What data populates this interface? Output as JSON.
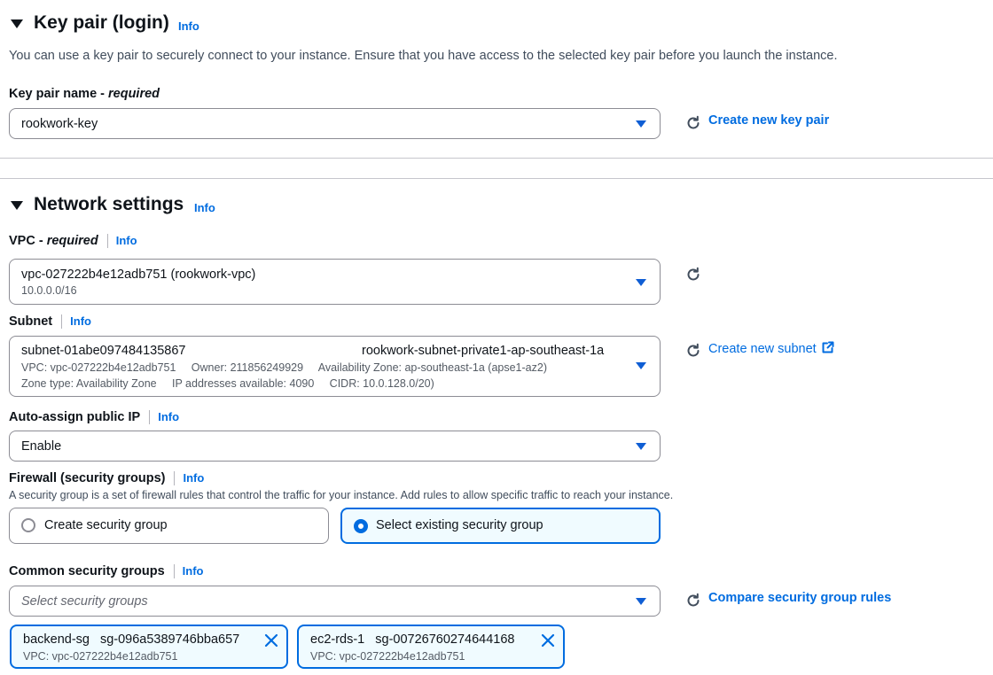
{
  "key_pair": {
    "title": "Key pair (login)",
    "info": "Info",
    "description": "You can use a key pair to securely connect to your instance. Ensure that you have access to the selected key pair before you launch the instance.",
    "label": "Key pair name - ",
    "label_required": "required",
    "selected": "rookwork-key",
    "create_link": "Create new key pair"
  },
  "network": {
    "title": "Network settings",
    "info": "Info",
    "vpc": {
      "label": "VPC - ",
      "label_required": "required",
      "info": "Info",
      "value": "vpc-027222b4e12adb751 (rookwork-vpc)",
      "sub": "10.0.0.0/16"
    },
    "subnet": {
      "label": "Subnet",
      "info": "Info",
      "id": "subnet-01abe097484135867",
      "name": "rookwork-subnet-private1-ap-southeast-1a",
      "line2": "VPC: vpc-027222b4e12adb751     Owner: 211856249929     Availability Zone: ap-southeast-1a (apse1-az2)",
      "line3": "Zone type: Availability Zone     IP addresses available: 4090     CIDR: 10.0.128.0/20)",
      "create_link": "Create new subnet"
    },
    "public_ip": {
      "label": "Auto-assign public IP",
      "info": "Info",
      "value": "Enable"
    },
    "firewall": {
      "label": "Firewall (security groups)",
      "info": "Info",
      "description": "A security group is a set of firewall rules that control the traffic for your instance. Add rules to allow specific traffic to reach your instance.",
      "option_create": "Create security group",
      "option_existing": "Select existing security group"
    },
    "common_sg": {
      "label": "Common security groups",
      "info": "Info",
      "placeholder": "Select security groups",
      "compare_link": "Compare security group rules",
      "tokens": [
        {
          "name": "backend-sg",
          "id": "sg-096a5389746bba657",
          "vpc": "VPC: vpc-027222b4e12adb751"
        },
        {
          "name": "ec2-rds-1",
          "id": "sg-00726760274644168",
          "vpc": "VPC: vpc-027222b4e12adb751"
        }
      ]
    }
  },
  "colors": {
    "link": "#006ce0",
    "text": "#0f141a",
    "border": "#8c8c94",
    "selected_bg": "#f0fbff"
  },
  "icons": {
    "collapse": "caret-down-icon",
    "dropdown": "dropdown-triangle-icon",
    "refresh": "refresh-icon",
    "external": "external-link-icon",
    "remove": "close-icon"
  }
}
